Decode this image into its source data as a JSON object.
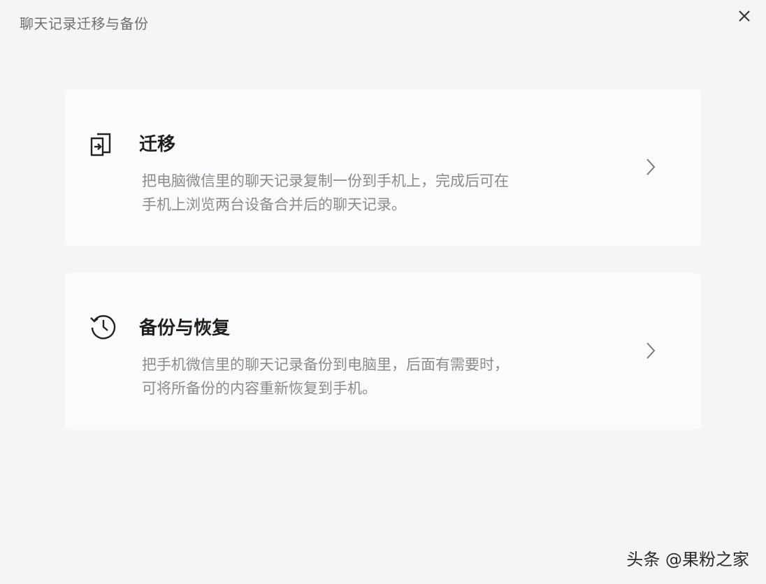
{
  "window": {
    "title": "聊天记录迁移与备份"
  },
  "icons": {
    "close": "close-icon",
    "migrate": "import-arrow-icon",
    "backup": "history-clock-icon",
    "chevron": "chevron-right-icon"
  },
  "cards": [
    {
      "title": "迁移",
      "desc_line1": "把电脑微信里的聊天记录复制一份到手机上，完成后可在",
      "desc_line2": "手机上浏览两台设备合并后的聊天记录。"
    },
    {
      "title": "备份与恢复",
      "desc_line1": "把手机微信里的聊天记录备份到电脑里，后面有需要时，",
      "desc_line2": "可将所备份的内容重新恢复到手机。"
    }
  ],
  "watermark": "头条 @果粉之家"
}
